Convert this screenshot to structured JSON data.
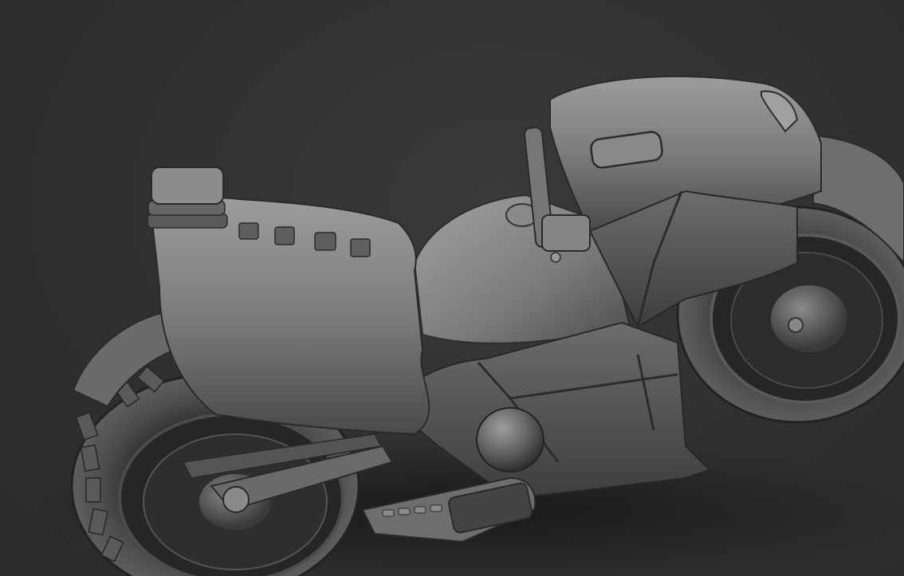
{
  "scene": {
    "subject": "motorcycle-clay-render",
    "colors": {
      "background": "#303030",
      "clay_light": "#9a9a9a",
      "clay_mid": "#6f6f6f",
      "clay_dark": "#3c3c3c",
      "shadow": "#1e1e1e"
    }
  }
}
